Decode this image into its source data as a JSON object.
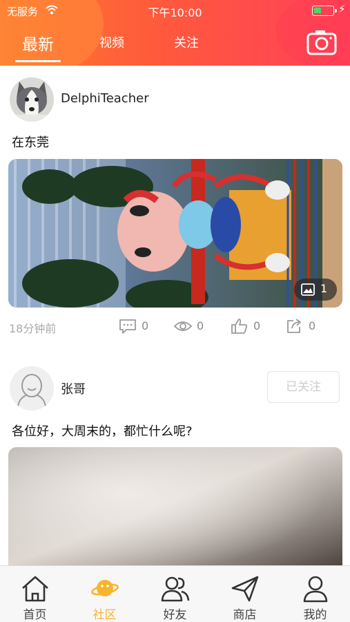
{
  "status_bar": {
    "carrier": "无服务",
    "time": "下午10:00"
  },
  "header": {
    "tabs": [
      {
        "label": "最新",
        "active": true
      },
      {
        "label": "视频",
        "active": false
      },
      {
        "label": "关注",
        "active": false
      }
    ],
    "camera_icon": "camera-icon",
    "accent_gradient": [
      "#ff7a2a",
      "#ff3f5a"
    ]
  },
  "posts": [
    {
      "username": "DelphiTeacher",
      "text": "在东莞",
      "image_count": "1",
      "time_ago": "18分钟前",
      "comments": "0",
      "views": "0",
      "likes": "0",
      "shares": "0"
    },
    {
      "username": "张哥",
      "text": "各位好，大周末的，都忙什么呢?",
      "follow_label": "已关注"
    }
  ],
  "bottom_nav": {
    "items": [
      {
        "label": "首页",
        "icon": "home-icon",
        "active": false
      },
      {
        "label": "社区",
        "icon": "planet-icon",
        "active": true
      },
      {
        "label": "好友",
        "icon": "friends-icon",
        "active": false
      },
      {
        "label": "商店",
        "icon": "paper-plane-icon",
        "active": false
      },
      {
        "label": "我的",
        "icon": "profile-icon",
        "active": false
      }
    ],
    "active_color": "#f7b52c"
  }
}
